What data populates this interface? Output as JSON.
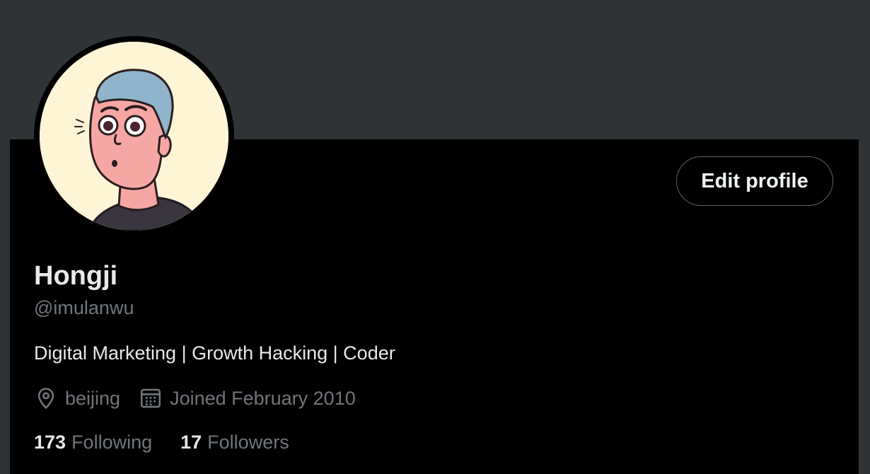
{
  "theme": {
    "background": "#000000",
    "banner": "#2f3336",
    "text_primary": "#e7e9ea",
    "text_secondary": "#71767b",
    "button_border": "#536471"
  },
  "profile": {
    "avatar_icon": "cartoon-avatar",
    "edit_button_label": "Edit profile",
    "display_name": "Hongji",
    "handle": "@imulanwu",
    "bio": "Digital Marketing | Growth Hacking | Coder",
    "location_icon": "location-pin-icon",
    "location": "beijing",
    "joined_icon": "calendar-icon",
    "joined": "Joined February 2010",
    "following_count": "173",
    "following_label": "Following",
    "followers_count": "17",
    "followers_label": "Followers"
  }
}
